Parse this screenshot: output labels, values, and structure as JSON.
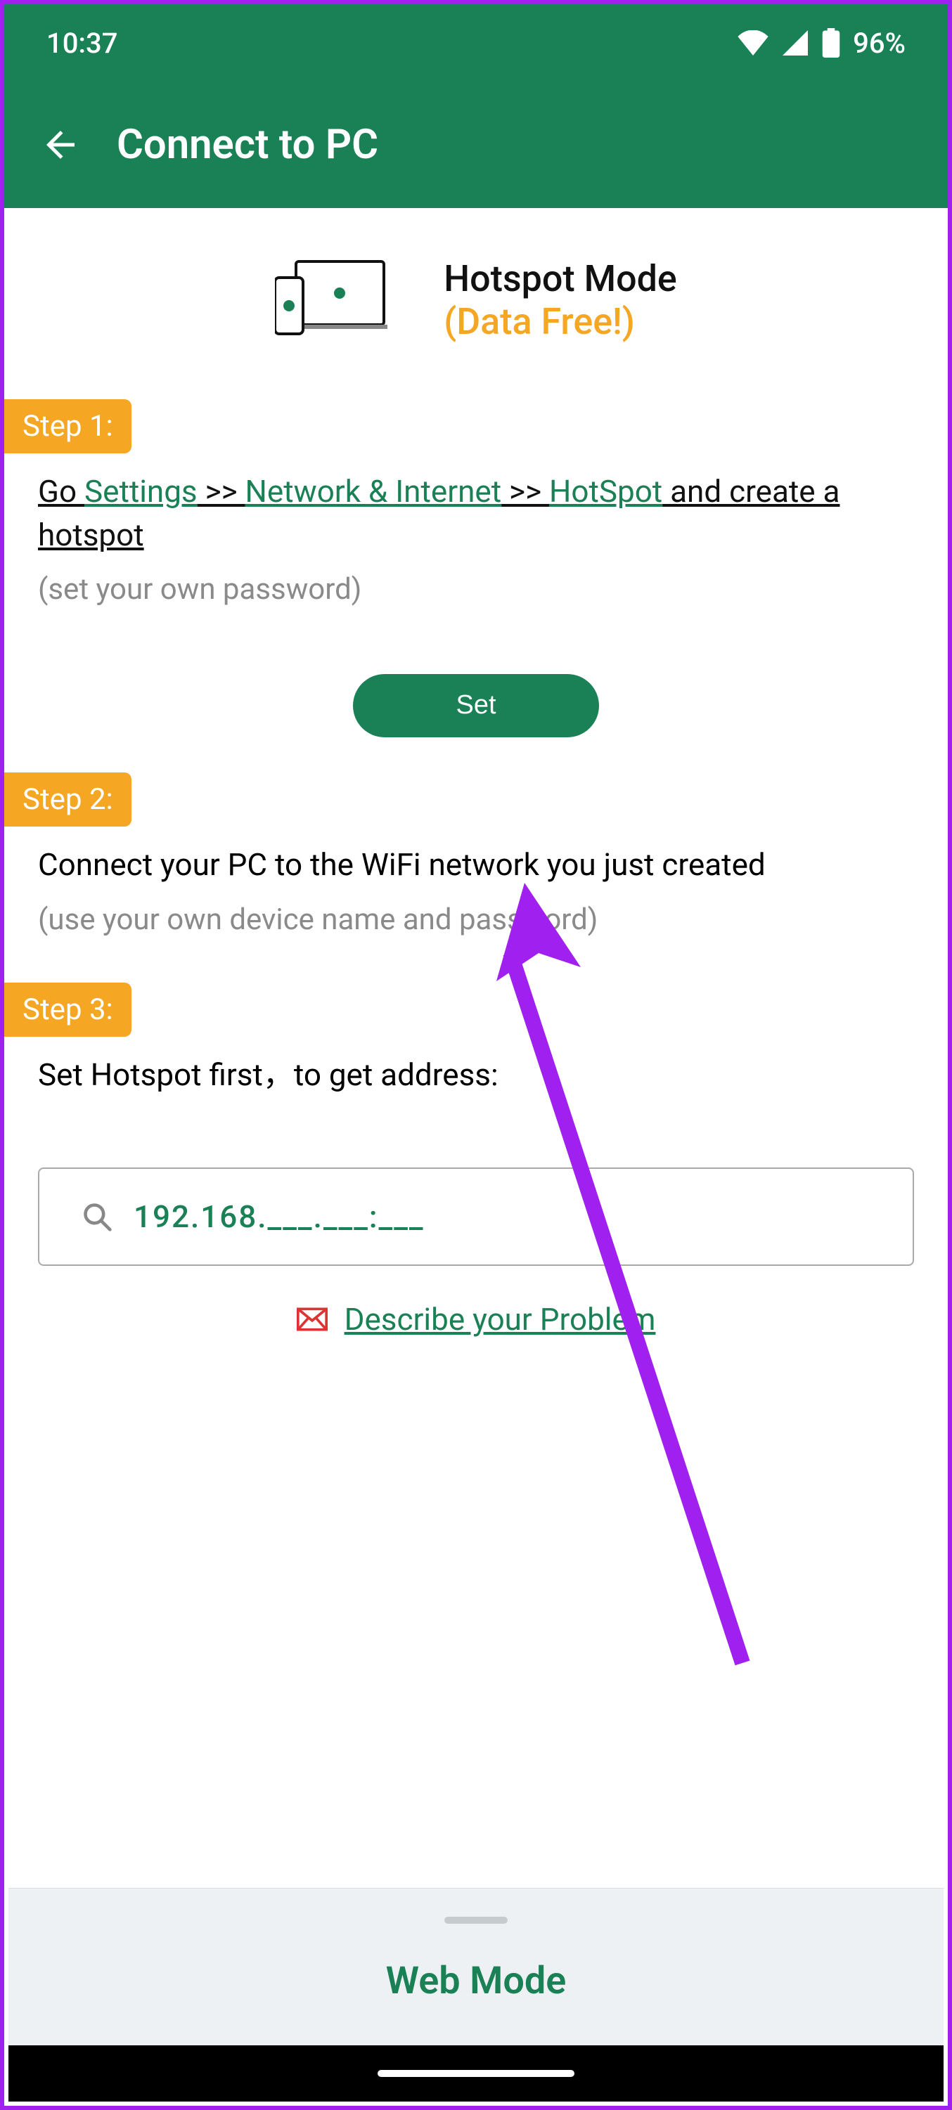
{
  "status": {
    "time": "10:37",
    "battery": "96%"
  },
  "app": {
    "title": "Connect to PC"
  },
  "mode": {
    "title": "Hotspot Mode",
    "subtitle": "(Data Free!)"
  },
  "steps": {
    "s1": {
      "badge": "Step 1:",
      "go": "Go ",
      "settings": "Settings",
      "sep1": " >> ",
      "network": "Network & Internet",
      "sep2": " >> ",
      "hotspot": "HotSpot",
      "tail": " and create a hotspot",
      "hint": "(set your own password)",
      "button": "Set"
    },
    "s2": {
      "badge": "Step 2:",
      "text": "Connect your PC to the WiFi network you just created",
      "hint": "(use your own device name and password)"
    },
    "s3": {
      "badge": "Step 3:",
      "text": "Set Hotspot first，to get address:"
    }
  },
  "ip": {
    "value": "192.168.___.___:___"
  },
  "problem": {
    "label": "Describe your Problem"
  },
  "bottom": {
    "mode": "Web Mode"
  }
}
